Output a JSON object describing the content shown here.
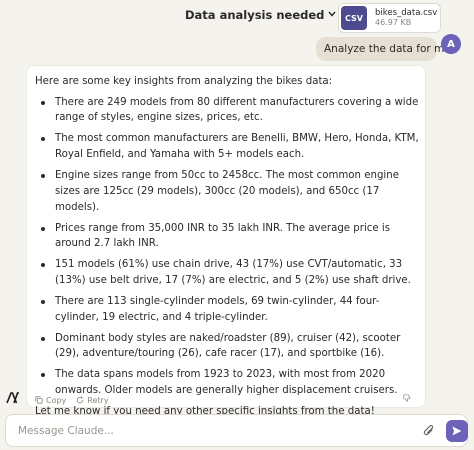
{
  "header": {
    "title": "Data analysis needed",
    "chevron_icon": "chevron-down-icon"
  },
  "attachment": {
    "badge": "CSV",
    "file_name": "bikes_data.csv",
    "file_size": "46.97 KB"
  },
  "user_message": {
    "text": "Analyze the data for me.",
    "avatar_initial": "A"
  },
  "assistant_message": {
    "intro": "Here are some key insights from analyzing the bikes data:",
    "insights": [
      "There are 249 models from 80 different manufacturers covering a wide range of styles, engine sizes, prices, etc.",
      "The most common manufacturers are Benelli, BMW, Hero, Honda, KTM, Royal Enfield, and Yamaha with 5+ models each.",
      "Engine sizes range from 50cc to 2458cc. The most common engine sizes are 125cc (29 models), 300cc (20 models), and 650cc (17 models).",
      "Prices range from 35,000 INR to 35 lakh INR. The average price is around 2.7 lakh INR.",
      "151 models (61%) use chain drive, 43 (17%) use CVT/automatic, 33 (13%) use belt drive, 17 (7%) are electric, and 5 (2%) use shaft drive.",
      "There are 113 single-cylinder models, 69 twin-cylinder, 44 four-cylinder, 19 electric, and 4 triple-cylinder.",
      "Dominant body styles are naked/roadster (89), cruiser (42), scooter (29), adventure/touring (26), cafe racer (17), and sportbike (16).",
      "The data spans models from 1923 to 2023, with most from 2020 onwards. Older models are generally higher displacement cruisers."
    ],
    "closing": "Let me know if you need any other specific insights from the data!",
    "actions": {
      "copy_label": "Copy",
      "retry_label": "Retry"
    }
  },
  "composer": {
    "placeholder": "Message Claude...",
    "value": ""
  },
  "colors": {
    "background": "#f5f3ed",
    "accent": "#6c63b8",
    "csv_badge": "#4e4a8f",
    "user_bubble": "#e5e0d3"
  }
}
